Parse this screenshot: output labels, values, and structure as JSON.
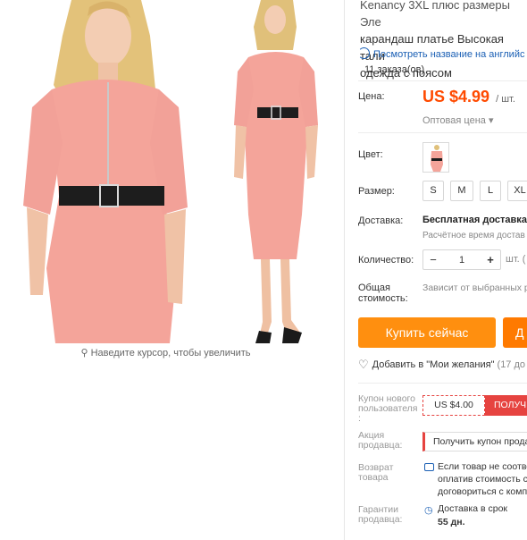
{
  "product": {
    "title_line1": "Kenancy 3XL плюс размеры Эле",
    "title_line2": "карандаш платье Высокая тали",
    "title_line3": "одежда с поясом",
    "translate_link": "Посмотреть название на английс",
    "orders": "11 заказа(ов)"
  },
  "price": {
    "label": "Цена:",
    "value": "US $4.99",
    "unit": "/ шт.",
    "wholesale": "Оптовая цена ▾",
    "accent": "#ff4a00"
  },
  "color": {
    "label": "Цвет:"
  },
  "size": {
    "label": "Размер:",
    "options": [
      "S",
      "M",
      "L",
      "XL"
    ]
  },
  "shipping": {
    "label": "Доставка:",
    "value": "Бесплатная доставка в",
    "estimate": "Расчётное время достав"
  },
  "quantity": {
    "label": "Количество:",
    "minus": "−",
    "value": "1",
    "plus": "+",
    "unit": "шт. ("
  },
  "total": {
    "label_line1": "Общая",
    "label_line2": "стоимость:",
    "value": "Зависит от выбранных р"
  },
  "buttons": {
    "buy_now": "Купить сейчас",
    "add_to_cart": "Д",
    "buy_color": "#ff8f0f"
  },
  "wishlist": {
    "label": "Добавить в \"Мои желания\"",
    "count": "(17 до"
  },
  "coupons": {
    "new_user_label_1": "Купон нового",
    "new_user_label_2": "пользователя",
    "new_user_label_3": ":",
    "new_user_value": "US $4.00",
    "new_user_button": "ПОЛУЧ",
    "seller_label_1": "Акция",
    "seller_label_2": "продавца:",
    "seller_value": "Получить купон прода"
  },
  "returns": {
    "label_1": "Возврат",
    "label_2": "товара",
    "line1": "Если товар не соотве",
    "line2": "оплатив стоимость с",
    "line3": "договориться с комп"
  },
  "guarantee": {
    "label_1": "Гарантии",
    "label_2": "продавца:",
    "line1": "Доставка в срок",
    "days": "55 дн."
  },
  "gallery": {
    "zoom_hint": "Наведите курсор, чтобы увеличить"
  }
}
